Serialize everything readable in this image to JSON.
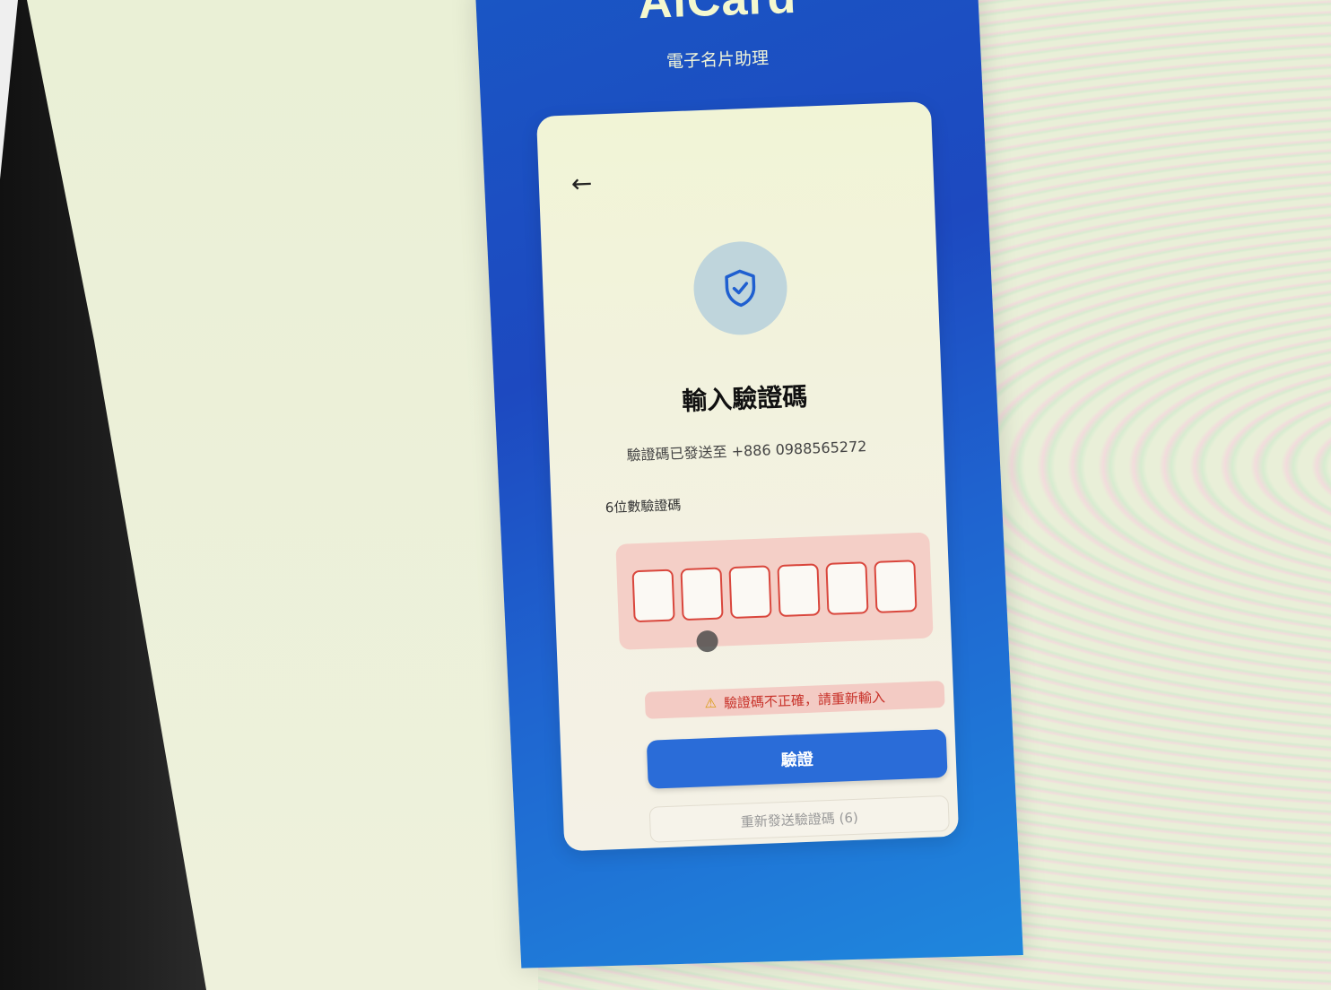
{
  "brand": {
    "title": "AiCard",
    "subtitle": "電子名片助理"
  },
  "card": {
    "back_icon": "arrow-left-icon",
    "back_glyph": "←",
    "shield_icon": "shield-check-icon",
    "title": "輸入驗證碼",
    "description": "驗證碼已發送至 +886 0988565272",
    "code_label": "6位數驗證碼",
    "otp_digits": [
      "",
      "",
      "",
      "",
      "",
      ""
    ],
    "error_icon": "warning-icon",
    "error_glyph": "⚠",
    "error_message": "驗證碼不正確，請重新輸入",
    "verify_label": "驗證",
    "resend_label": "重新發送驗證碼 (6)"
  },
  "colors": {
    "panel_blue": "#1d49c0",
    "accent_button": "#2a6cd8",
    "error_red": "#d9463c",
    "error_bg": "#f3cbc4"
  }
}
